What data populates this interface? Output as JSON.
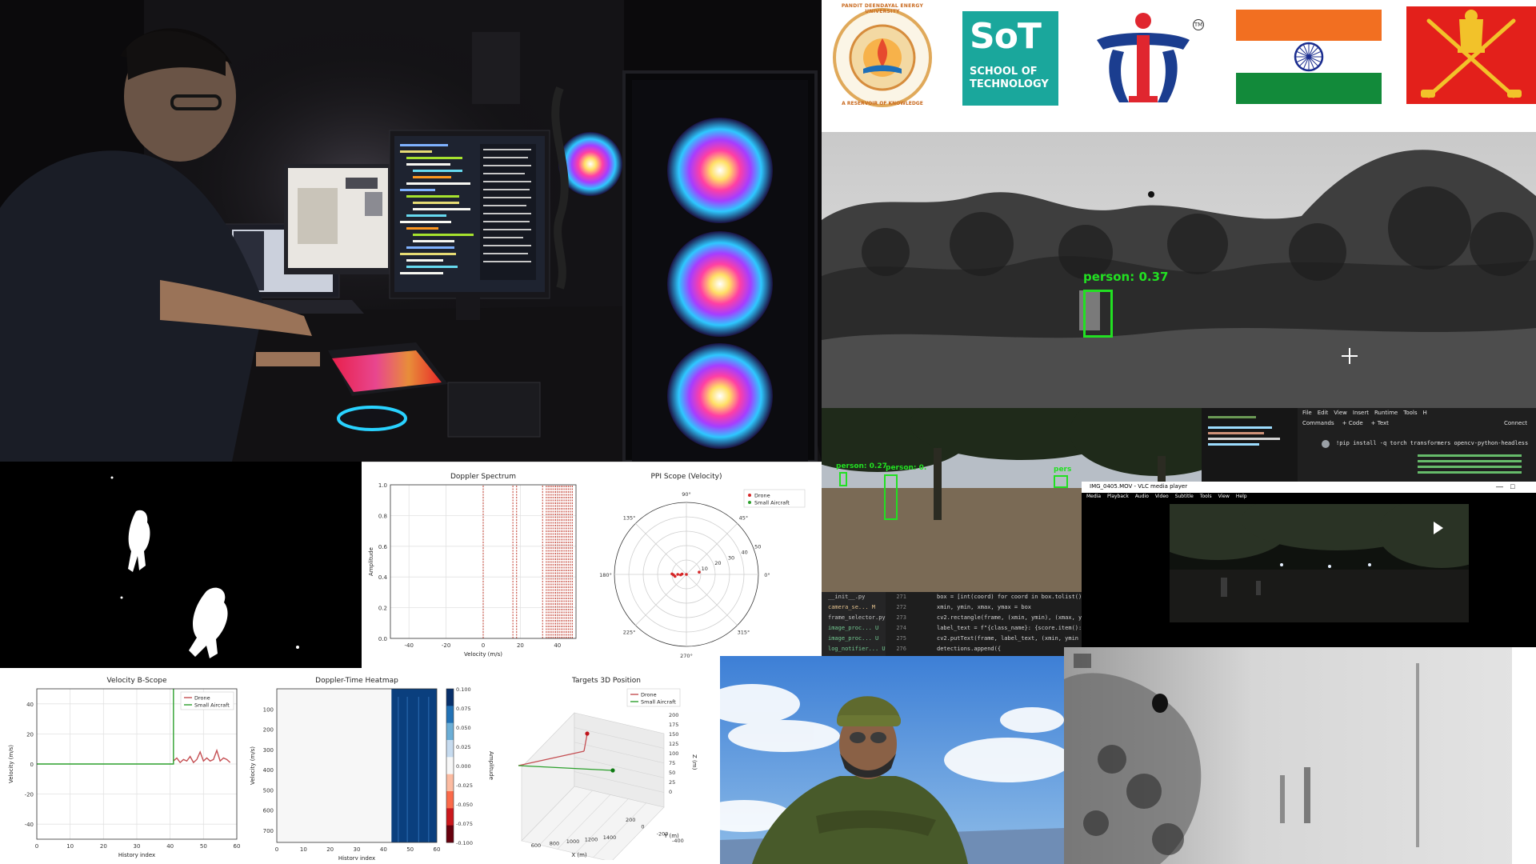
{
  "logos": {
    "pdeu_text": "PANDIT DEENDAYAL ENERGY UNIVERSITY",
    "pdeu_motto": "A RESERVOIR OF KNOWLEDGE",
    "sot_short": "SoT",
    "sot_line1": "SCHOOL OF",
    "sot_line2": "TECHNOLOGY",
    "tm": "TM"
  },
  "detections": {
    "night_label": "person: 0.37",
    "park_label_1": "person: 0.27",
    "park_label_2": "person: 0.",
    "park_label_3": "pers"
  },
  "code": {
    "files": [
      "__init__.py",
      "camera_se... M",
      "frame_selector.py",
      "image_proc... U",
      "image_proc... U",
      "log_notifier... U"
    ],
    "line_numbers": [
      "271",
      "272",
      "273",
      "274",
      "275",
      "276"
    ],
    "lines": [
      "box = [int(coord) for coord in box.tolist()]",
      "xmin, ymin, xmax, ymax = box",
      "cv2.rectangle(frame, (xmin, ymin), (xmax, ymax)",
      "label_text = f\"{class_name}: {score.item():.2f",
      "cv2.putText(frame, label_text, (xmin, ymin - 10",
      "detections.append({"
    ]
  },
  "colab": {
    "menu": [
      "File",
      "Edit",
      "View",
      "Insert",
      "Runtime",
      "Tools",
      "H"
    ],
    "toolbar": [
      "Commands",
      "+ Code",
      "+ Text"
    ],
    "connect": "Connect",
    "cell": "!pip install -q torch transformers opencv-python-headless"
  },
  "vlc": {
    "title": "IMG_0405.MOV - VLC media player",
    "menu": [
      "Media",
      "Playback",
      "Audio",
      "Video",
      "Subtitle",
      "Tools",
      "View",
      "Help"
    ]
  },
  "chart_data": [
    {
      "type": "line",
      "title": "Doppler Spectrum",
      "xlabel": "Velocity (m/s)",
      "ylabel": "Amplitude",
      "xlim": [
        -50,
        50
      ],
      "ylim": [
        0,
        1.0
      ],
      "xticks": [
        -40,
        -20,
        0,
        20,
        40
      ],
      "yticks": [
        "0.0",
        "0.2",
        "0.4",
        "0.6",
        "0.8",
        "1.0"
      ],
      "grid": true,
      "color": "#c0392b",
      "stems": [
        0,
        16,
        18,
        32,
        34,
        35,
        36,
        37,
        38,
        39,
        40,
        41,
        42,
        43,
        44,
        45,
        46,
        47,
        48
      ]
    },
    {
      "type": "scatter",
      "title": "PPI Scope (Velocity)",
      "polar": true,
      "angle_labels": [
        "90°",
        "45°",
        "0°",
        "315°",
        "270°",
        "225°",
        "180°",
        "135°"
      ],
      "radial_labels": [
        "10",
        "20",
        "30",
        "40",
        "50"
      ],
      "rmax": 50,
      "legend": [
        "Drone",
        "Small Aircraft"
      ],
      "legend_position": "top-right",
      "series": [
        {
          "name": "Drone",
          "color": "#d62728",
          "points": [
            [
              0,
              0
            ],
            [
              175,
              3
            ],
            [
              180,
              6
            ],
            [
              182,
              9
            ],
            [
              178,
              10
            ],
            [
              185,
              4
            ],
            [
              190,
              8
            ],
            [
              10,
              9
            ]
          ]
        },
        {
          "name": "Small Aircraft",
          "color": "#2ca02c",
          "points": []
        }
      ]
    },
    {
      "type": "line",
      "title": "Velocity B-Scope",
      "xlabel": "History index",
      "ylabel": "Velocity (m/s)",
      "xlim": [
        0,
        60
      ],
      "ylim": [
        -50,
        50
      ],
      "xticks": [
        0,
        10,
        20,
        30,
        40,
        50,
        60
      ],
      "yticks": [
        40,
        20,
        0,
        -20,
        -40
      ],
      "grid": true,
      "legend": [
        "Drone",
        "Small Aircraft"
      ],
      "legend_position": "top-right",
      "series": [
        {
          "name": "Drone",
          "color": "#c44e52",
          "x": [
            41,
            42,
            43,
            44,
            45,
            46,
            47,
            48,
            49,
            50,
            51,
            52,
            53,
            54,
            55,
            56,
            57,
            58
          ],
          "y": [
            2,
            4,
            1,
            3,
            2,
            5,
            1,
            3,
            8,
            2,
            4,
            2,
            3,
            9,
            2,
            4,
            3,
            1
          ]
        },
        {
          "name": "Small Aircraft",
          "color": "#2ca02c",
          "x": [
            0,
            40,
            41,
            41
          ],
          "y": [
            0,
            0,
            0,
            50
          ]
        }
      ]
    },
    {
      "type": "heatmap",
      "title": "Doppler-Time Heatmap",
      "xlabel": "History index",
      "ylabel": "Velocity (m/s)",
      "xticks": [
        0,
        10,
        20,
        30,
        40,
        50,
        60
      ],
      "yticks": [
        100,
        200,
        300,
        400,
        500,
        600,
        700
      ],
      "colorbar_ticks": [
        "0.100",
        "0.075",
        "0.050",
        "0.025",
        "0.000",
        "-0.025",
        "-0.050",
        "-0.075",
        "-0.100"
      ],
      "colorbar_label": "Amplitude",
      "filled_from_index": 43
    },
    {
      "type": "line",
      "title": "Targets 3D Position",
      "three_d": true,
      "xlabel": "X (m)",
      "ylabel": "Y (m)",
      "zlabel": "Z (m)",
      "xticks": [
        600,
        800,
        1000,
        1200,
        1400
      ],
      "yticks": [
        -400,
        -200,
        0,
        200
      ],
      "zticks": [
        0,
        25,
        50,
        75,
        100,
        125,
        150,
        175,
        200
      ],
      "legend": [
        "Drone",
        "Small Aircraft"
      ],
      "legend_position": "top-right",
      "series": [
        {
          "name": "Drone",
          "color": "#c44e52"
        },
        {
          "name": "Small Aircraft",
          "color": "#2ca02c"
        }
      ]
    }
  ]
}
